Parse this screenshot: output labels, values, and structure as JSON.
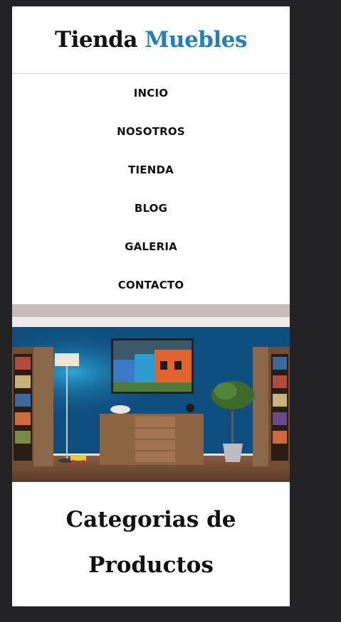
{
  "header": {
    "brand_part1": "Tienda",
    "brand_part2": "Muebles"
  },
  "nav": {
    "items": [
      "INCIO",
      "NOSOTROS",
      "TIENDA",
      "BLOG",
      "GALERIA",
      "CONTACTO"
    ]
  },
  "hero": {
    "alt": "Sala con pared azul, muebles de madera y planta"
  },
  "categories": {
    "title": "Categorias de Productos"
  },
  "colors": {
    "background": "#232325",
    "accent": "#1f7fc4",
    "wall": "#0f4f7f"
  }
}
